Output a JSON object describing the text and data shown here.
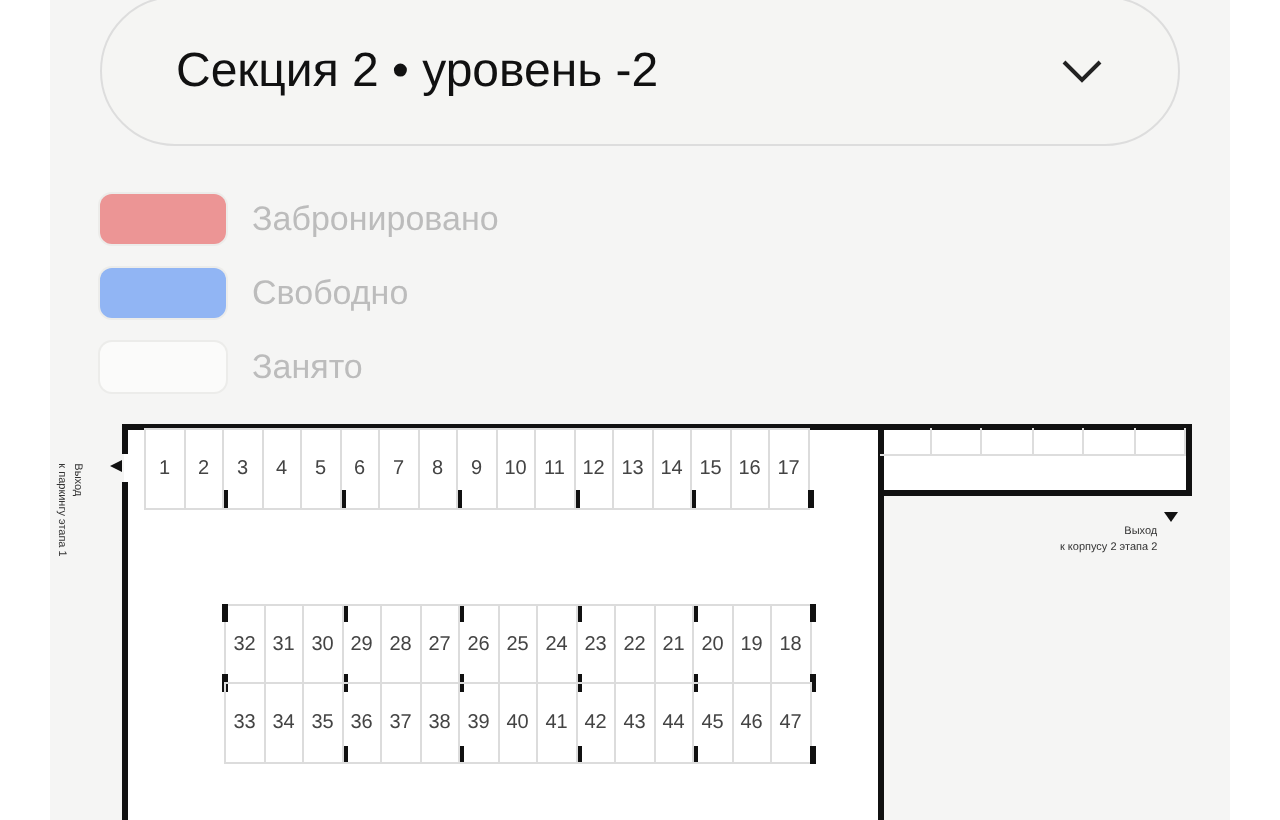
{
  "dropdown": {
    "label": "Секция 2 • уровень -2"
  },
  "legend": [
    {
      "label": "Забронировано",
      "color": "#ec9595"
    },
    {
      "label": "Свободно",
      "color": "#91b5f4"
    },
    {
      "label": "Занято",
      "color": "#fbfbfa"
    }
  ],
  "exits": [
    {
      "title": "Выход",
      "subtitle": "к паркингу этапа 1"
    },
    {
      "title": "Выход",
      "subtitle": "к корпусу 2 этапа 2"
    }
  ],
  "top_row": [
    [
      "1",
      "2"
    ],
    [
      "3",
      "4",
      "5"
    ],
    [
      "6",
      "7",
      "8"
    ],
    [
      "9",
      "10",
      "11"
    ],
    [
      "12",
      "13",
      "14"
    ],
    [
      "15",
      "16",
      "17"
    ]
  ],
  "middle_upper": [
    [
      "32",
      "31",
      "30"
    ],
    [
      "29",
      "28",
      "27"
    ],
    [
      "26",
      "25",
      "24"
    ],
    [
      "23",
      "22",
      "21"
    ],
    [
      "20",
      "19",
      "18"
    ]
  ],
  "middle_lower": [
    [
      "33",
      "34",
      "35"
    ],
    [
      "36",
      "37",
      "38"
    ],
    [
      "39",
      "40",
      "41"
    ],
    [
      "42",
      "43",
      "44"
    ],
    [
      "45",
      "46",
      "47"
    ]
  ]
}
